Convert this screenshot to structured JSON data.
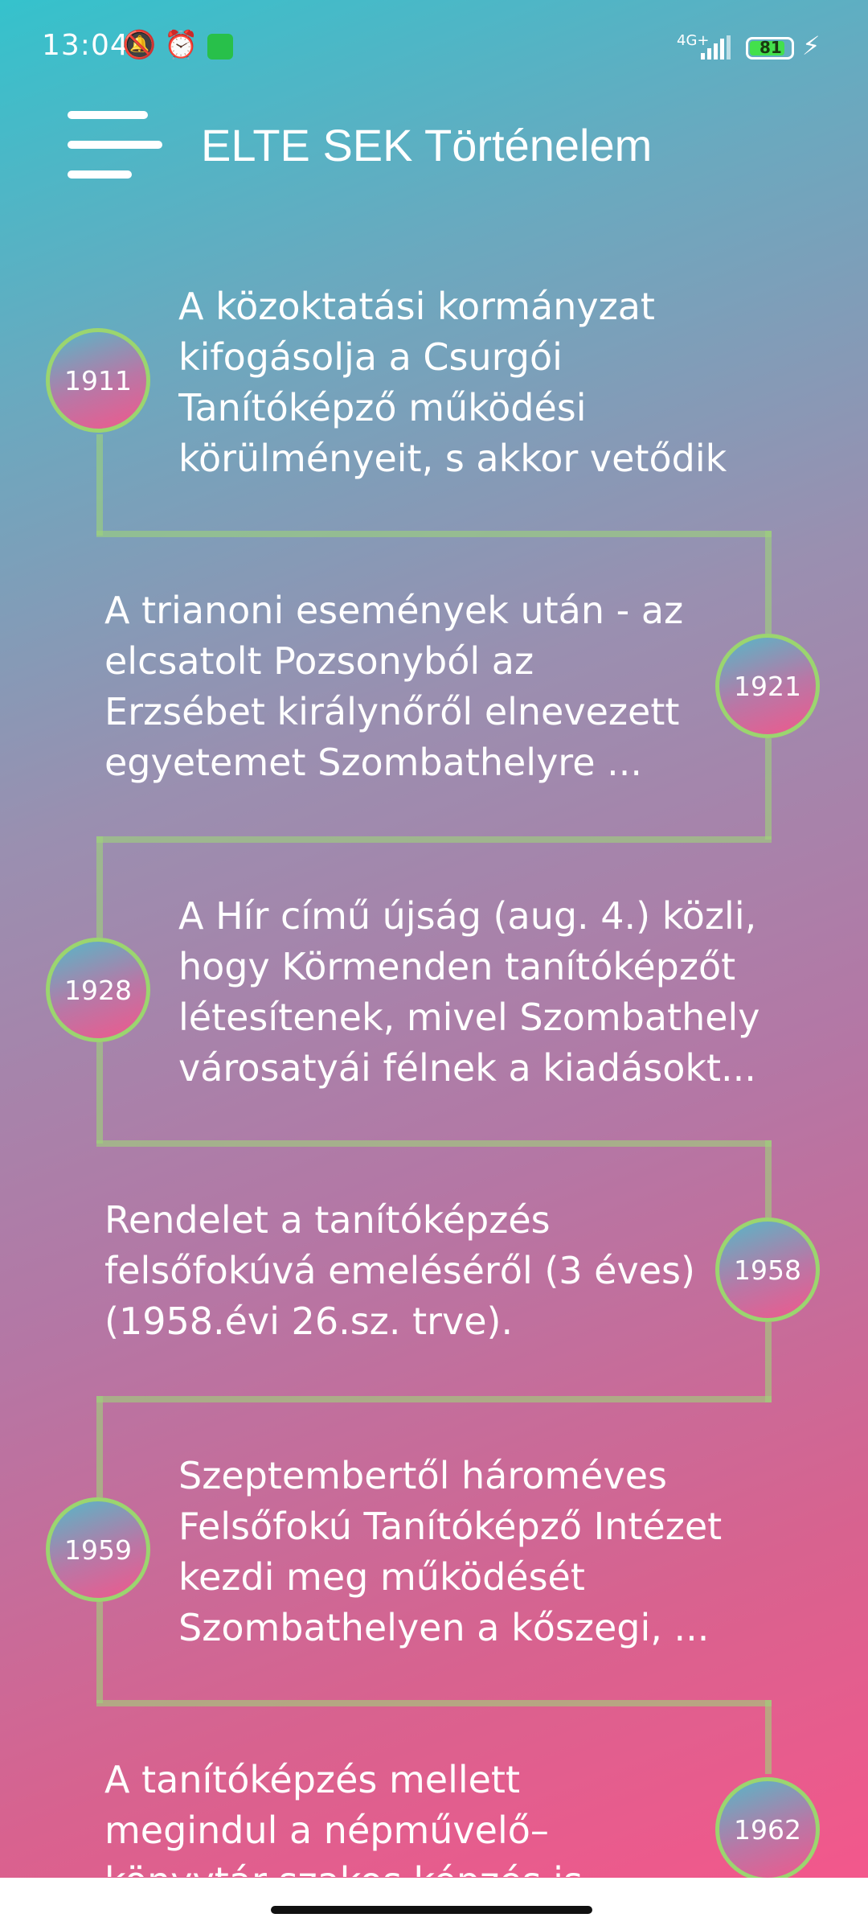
{
  "status_bar": {
    "time": "13:04",
    "network": "4G+",
    "battery": "81"
  },
  "header": {
    "title": "ELTE SEK Történelem"
  },
  "timeline": [
    {
      "year": "1911",
      "text": "A közoktatási kormányzat kifogásolja a Csurgói Tanítóképző működési körülményeit, s akkor vetődik ..."
    },
    {
      "year": "1921",
      "text": "A trianoni események után - az elcsatolt Pozsonyból az Erzsébet királynőről elnevezett egyetemet Szombathelyre ..."
    },
    {
      "year": "1928",
      "text": "A Hír című újság (aug. 4.) közli, hogy Körmenden tanítóképzőt létesítenek, mivel Szombathely városatyái félnek a kiadásokt..."
    },
    {
      "year": "1958",
      "text": "Rendelet a tanítóképzés felsőfokúvá emeléséről (3 éves) (1958.évi 26.sz. trve)."
    },
    {
      "year": "1959",
      "text": "Szeptembertől hároméves Felsőfokú Tanítóképző Intézet kezdi meg működését Szombathelyen a kőszegi, ..."
    },
    {
      "year": "1962",
      "text": "A tanítóképzés mellett megindul a népművelő–könyvtár szakos képzés is"
    }
  ]
}
